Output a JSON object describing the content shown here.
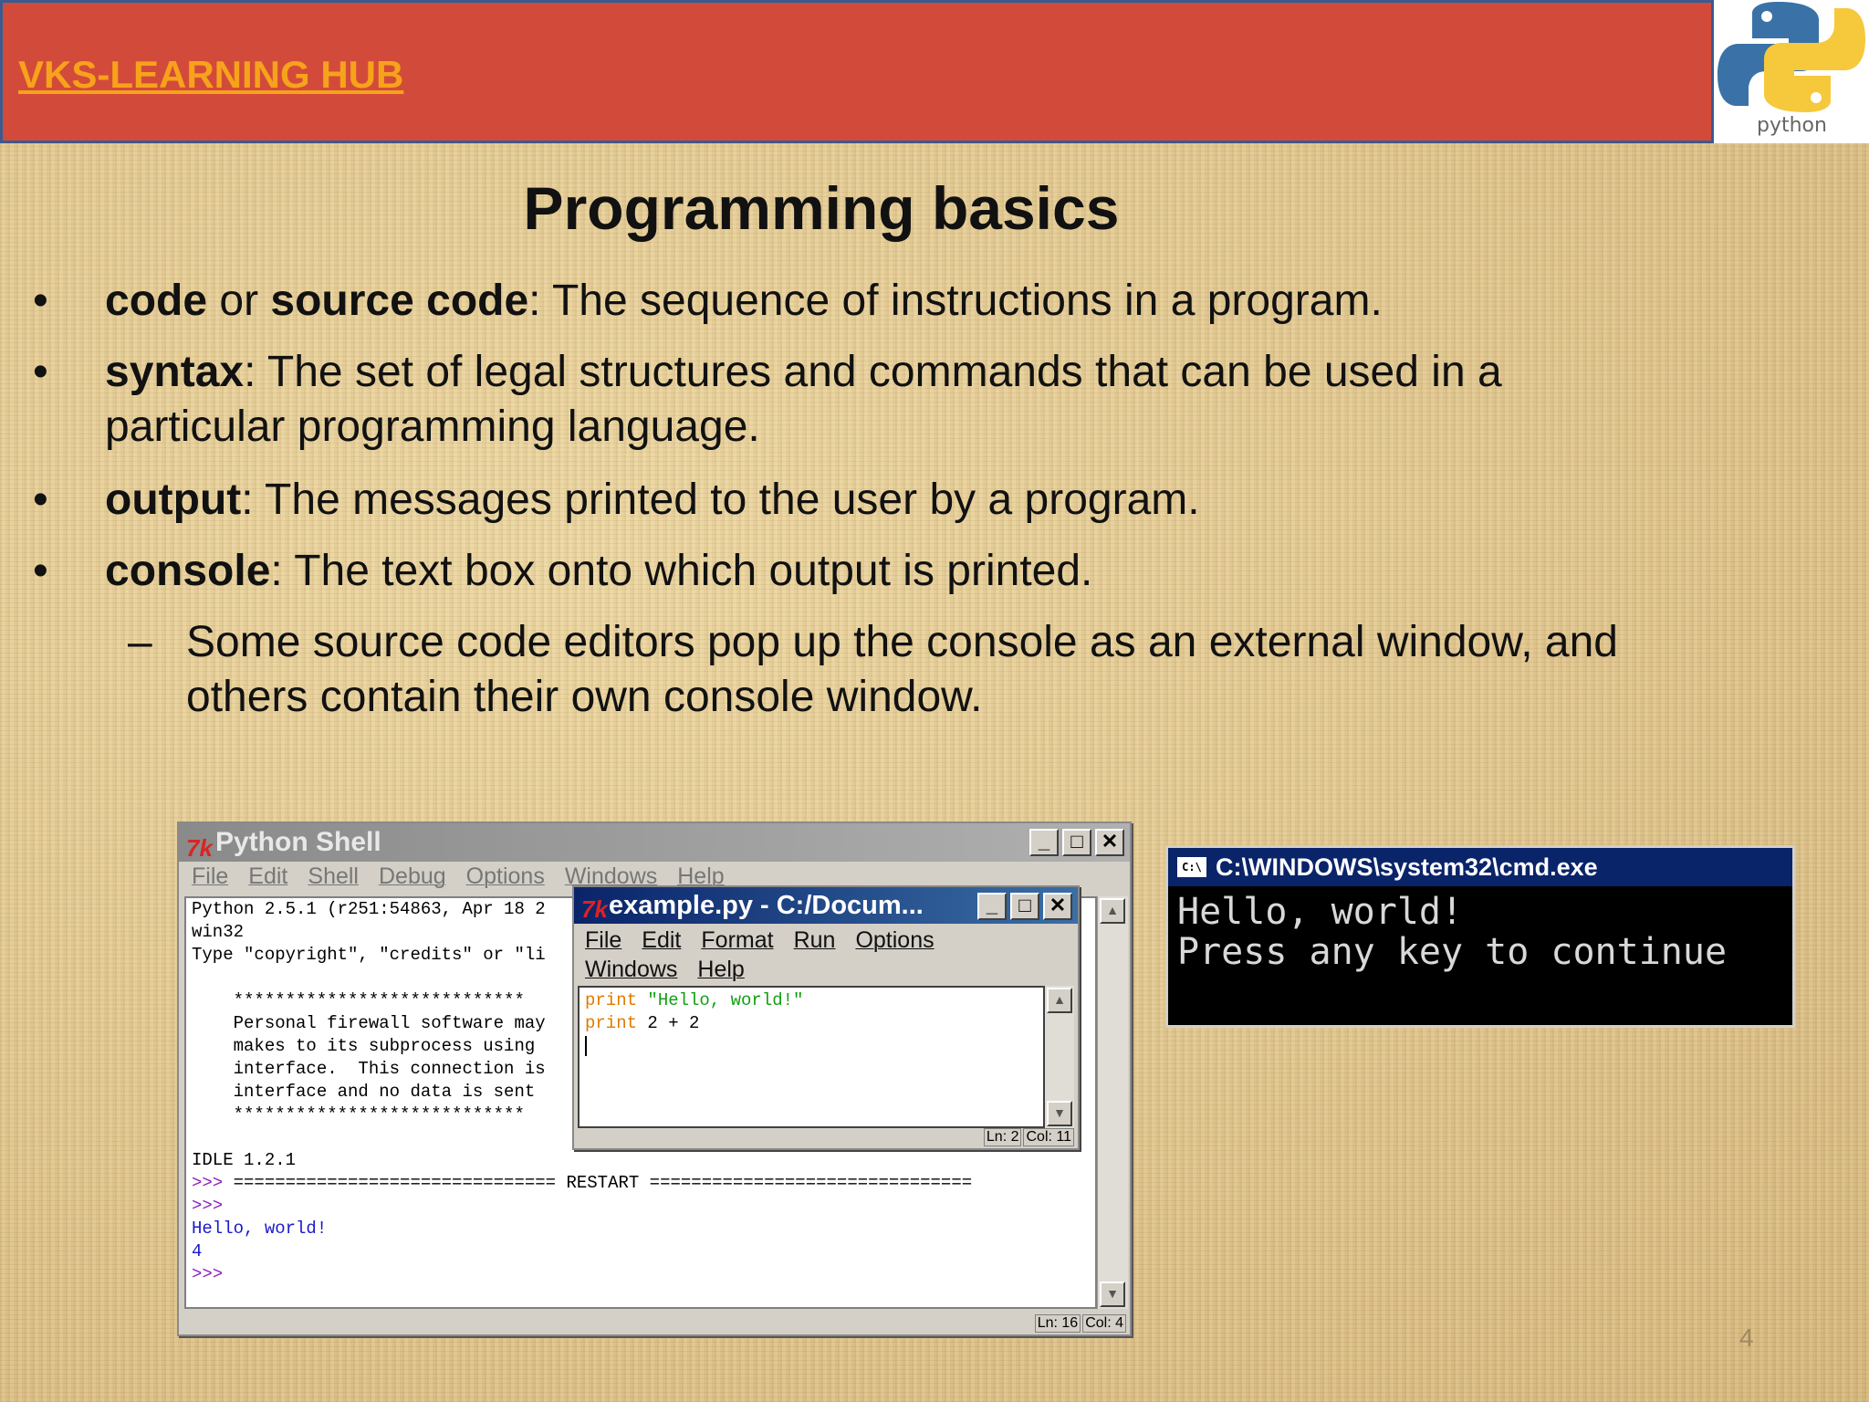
{
  "header": {
    "brand": "VKS-LEARNING  HUB",
    "logo_caption": "python",
    "banner_color": "#d24b3a",
    "brand_color": "#f7a21b"
  },
  "slide": {
    "title": "Programming basics",
    "page_number": "4",
    "bullets": [
      {
        "bold1": "code",
        "mid": " or ",
        "bold2": "source code",
        "rest": ": The sequence of instructions in a program."
      },
      {
        "bold1": "syntax",
        "rest": ": The set of legal structures and commands that can be used in a particular programming language."
      },
      {
        "bold1": "output",
        "rest": ": The messages printed to the user by a program."
      },
      {
        "bold1": "console",
        "rest": ": The text box onto which output is printed."
      }
    ],
    "sub_bullet": "Some source code editors pop up the console as an external window, and others contain their own console window.",
    "bullet_symbol": "•",
    "sub_symbol": "–"
  },
  "shell_window": {
    "title": "Python Shell",
    "menu": [
      "File",
      "Edit",
      "Shell",
      "Debug",
      "Options",
      "Windows",
      "Help"
    ],
    "lines": [
      "Python 2.5.1 (r251:54863, Apr 18 2",
      "win32",
      "Type \"copyright\", \"credits\" or \"li",
      "",
      "    ****************************",
      "    Personal firewall software may",
      "    makes to its subprocess using",
      "    interface.  This connection is",
      "    interface and no data is sent",
      "    ****************************",
      "",
      "IDLE 1.2.1"
    ],
    "restart_prompt": ">>> ",
    "restart_line": "=============================== RESTART ===============================",
    "prompt2": ">>>",
    "out1": "Hello, world!",
    "out2": "4",
    "prompt3": ">>>",
    "status_ln": "Ln: 16",
    "status_col": "Col: 4"
  },
  "editor_window": {
    "title": "example.py - C:/Docum...",
    "menu_row1": [
      "File",
      "Edit",
      "Format",
      "Run",
      "Options"
    ],
    "menu_row2": [
      "Windows",
      "Help"
    ],
    "code_kw1": "print",
    "code_str1": " \"Hello, world!\"",
    "code_kw2": "print",
    "code_rest2": " 2 + 2",
    "status_ln": "Ln: 2",
    "status_col": "Col: 11"
  },
  "cmd_window": {
    "icon_label": "C:\\",
    "title": "C:\\WINDOWS\\system32\\cmd.exe",
    "line1": "Hello, world!",
    "line2": "Press any key to continue"
  },
  "window_buttons": {
    "minimize": "_",
    "maximize": "□",
    "close": "✕",
    "scroll_up": "▲",
    "scroll_down": "▼"
  }
}
